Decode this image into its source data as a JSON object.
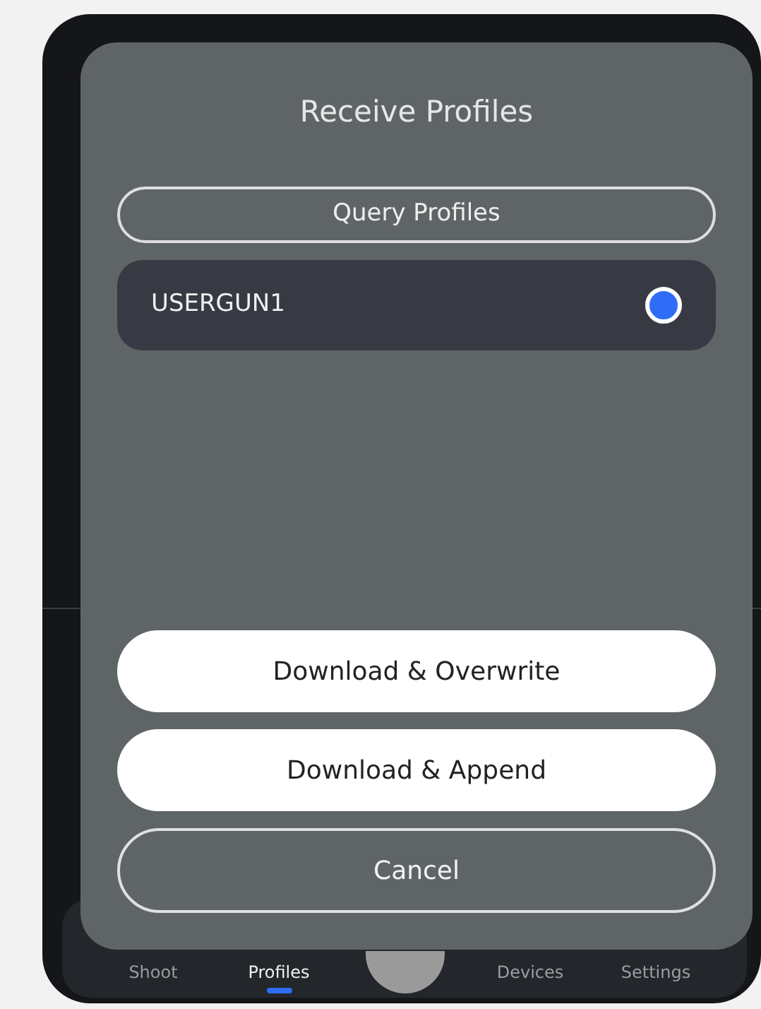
{
  "dialog": {
    "title": "Receive Profiles",
    "query_button": "Query Profiles",
    "profiles": [
      {
        "name": "USERGUN1",
        "selected": true
      }
    ],
    "actions": [
      {
        "label": "Download & Overwrite",
        "kind": "filled"
      },
      {
        "label": "Download & Append",
        "kind": "filled"
      },
      {
        "label": "Cancel",
        "kind": "outline"
      }
    ]
  },
  "bottom_nav": [
    {
      "label": "Shoot",
      "selected": false
    },
    {
      "label": "Profiles",
      "selected": true
    },
    {
      "label": "Devices",
      "selected": false
    },
    {
      "label": "Settings",
      "selected": false
    }
  ]
}
